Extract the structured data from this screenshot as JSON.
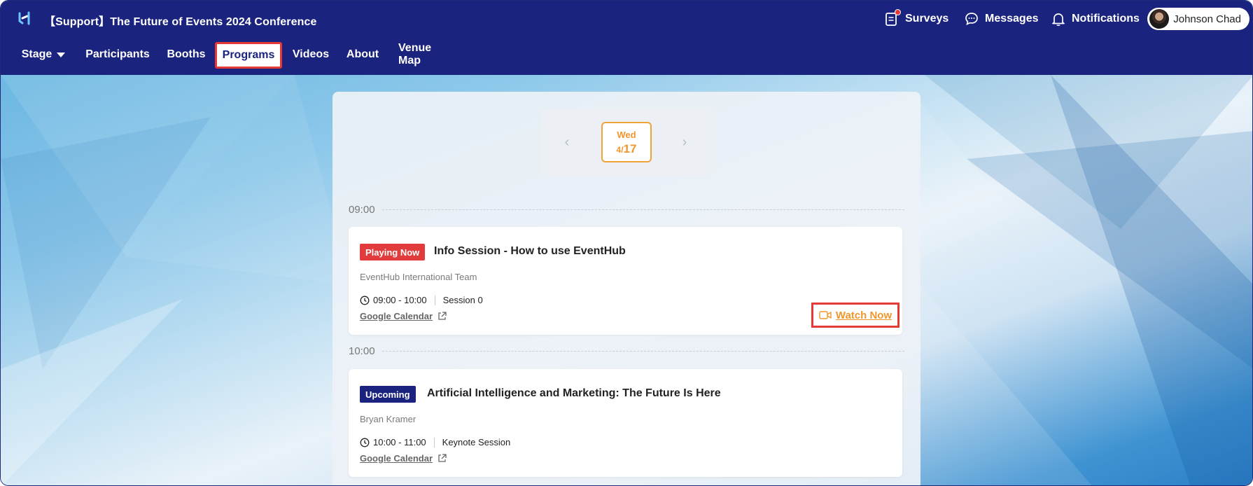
{
  "app": {
    "title": "【Support】The Future of Events 2024 Conference"
  },
  "top_actions": {
    "surveys": "Surveys",
    "messages": "Messages",
    "notifications": "Notifications"
  },
  "user": {
    "name": "Johnson Chad"
  },
  "nav": {
    "stage": "Stage",
    "participants": "Participants",
    "booths": "Booths",
    "programs": "Programs",
    "videos": "Videos",
    "about": "About",
    "venue_map": "Venue Map",
    "active": "Programs"
  },
  "date_nav": {
    "weekday": "Wed",
    "month": "4/",
    "day": "17",
    "prev_icon": "chevron-left-icon",
    "next_icon": "chevron-right-icon"
  },
  "schedule": [
    {
      "time": "09:00",
      "badge": "Playing Now",
      "title": "Info Session - How to use EventHub",
      "speaker": "EventHub International Team",
      "range": "09:00 - 10:00",
      "session": "Session 0",
      "calendar": "Google Calendar",
      "watch": "Watch Now"
    },
    {
      "time": "10:00",
      "badge": "Upcoming",
      "title": "Artificial Intelligence and Marketing: The Future Is Here",
      "speaker": "Bryan Kramer",
      "range": "10:00 - 11:00",
      "session": "Keynote Session",
      "calendar": "Google Calendar"
    }
  ],
  "colors": {
    "header": "#1a237e",
    "accent_orange": "#f0962b",
    "highlight_red": "#e53935",
    "badge_playing": "#e23b3b",
    "badge_upcoming": "#1a237e"
  }
}
